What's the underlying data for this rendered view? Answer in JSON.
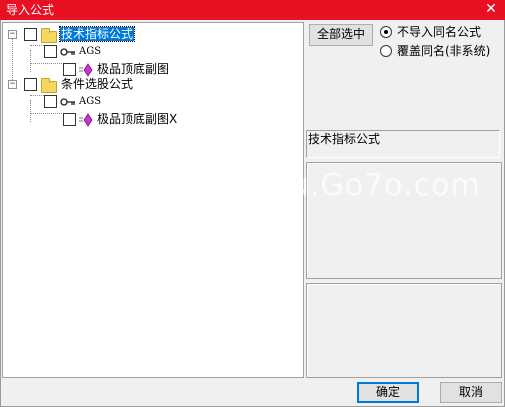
{
  "window": {
    "title": "导入公式",
    "close_icon": "close-icon"
  },
  "tree": [
    {
      "label": "技术指标公式",
      "type": "folder",
      "selected": true,
      "expander": "−"
    },
    {
      "label": "AGS",
      "type": "key"
    },
    {
      "label": "极品顶底副图",
      "type": "gem"
    },
    {
      "label": "条件选股公式",
      "type": "folder",
      "selected": false,
      "expander": "−"
    },
    {
      "label": "AGS",
      "type": "key"
    },
    {
      "label": "极品顶底副图X",
      "type": "gem"
    }
  ],
  "options": {
    "select_all_label": "全部选中",
    "radio_no_import": "不导入同名公式",
    "radio_overwrite": "覆盖同名(非系统)",
    "selected_radio": "no_import"
  },
  "info": {
    "category": "技术指标公式"
  },
  "watermark": "u.Go7o.com",
  "footer": {
    "ok_label": "确定",
    "cancel_label": "取消"
  },
  "colors": {
    "titlebar": "#e81123",
    "selection": "#0078d7",
    "folder": "#f5d760",
    "gem": "#cc33cc"
  }
}
